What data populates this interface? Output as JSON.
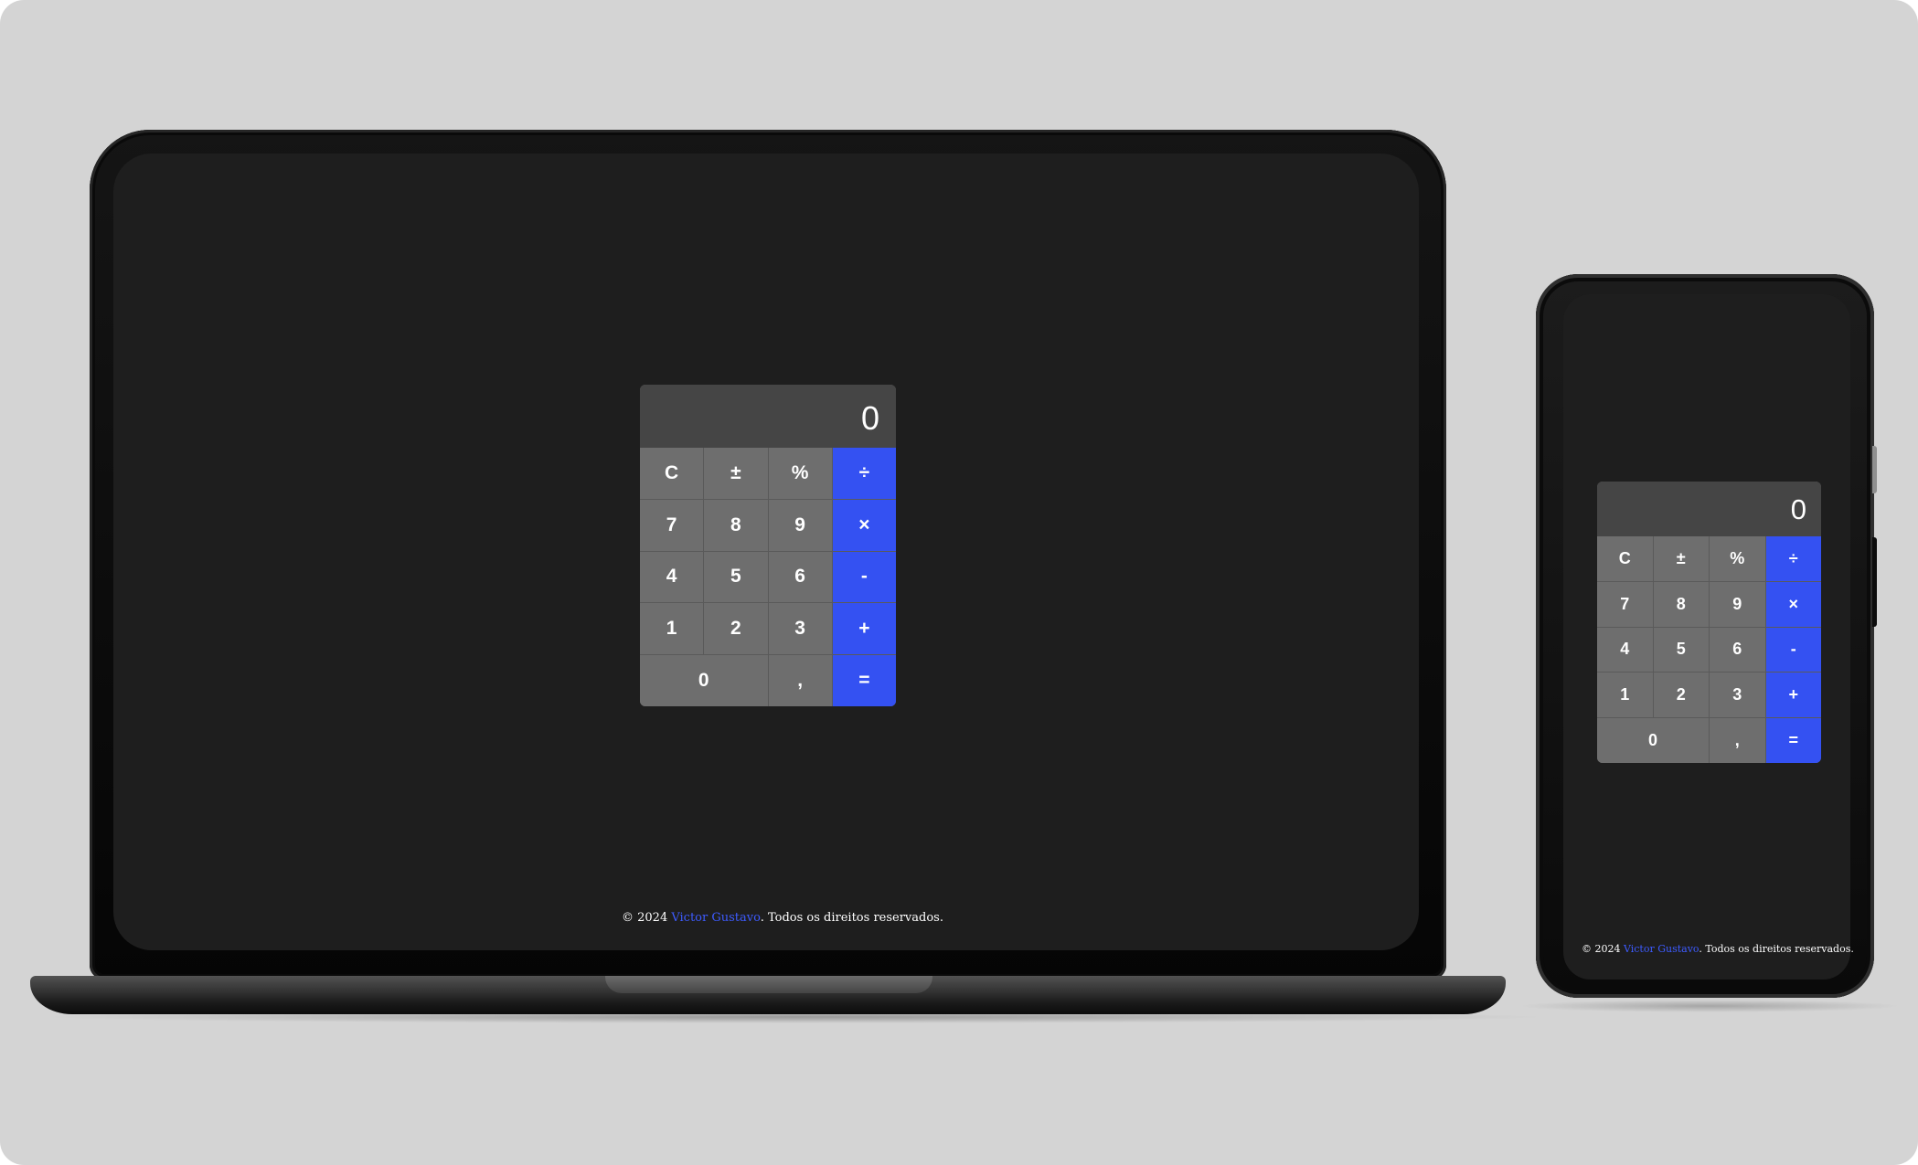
{
  "calculator": {
    "display_value": "0",
    "keys": [
      {
        "label": "C",
        "name": "clear-key",
        "type": "fn"
      },
      {
        "label": "±",
        "name": "sign-key",
        "type": "fn"
      },
      {
        "label": "%",
        "name": "percent-key",
        "type": "fn"
      },
      {
        "label": "÷",
        "name": "divide-key",
        "type": "op"
      },
      {
        "label": "7",
        "name": "digit-7-key",
        "type": "num"
      },
      {
        "label": "8",
        "name": "digit-8-key",
        "type": "num"
      },
      {
        "label": "9",
        "name": "digit-9-key",
        "type": "num"
      },
      {
        "label": "×",
        "name": "multiply-key",
        "type": "op"
      },
      {
        "label": "4",
        "name": "digit-4-key",
        "type": "num"
      },
      {
        "label": "5",
        "name": "digit-5-key",
        "type": "num"
      },
      {
        "label": "6",
        "name": "digit-6-key",
        "type": "num"
      },
      {
        "label": "-",
        "name": "subtract-key",
        "type": "op"
      },
      {
        "label": "1",
        "name": "digit-1-key",
        "type": "num"
      },
      {
        "label": "2",
        "name": "digit-2-key",
        "type": "num"
      },
      {
        "label": "3",
        "name": "digit-3-key",
        "type": "num"
      },
      {
        "label": "+",
        "name": "add-key",
        "type": "op"
      },
      {
        "label": "0",
        "name": "digit-0-key",
        "type": "zero"
      },
      {
        "label": ",",
        "name": "decimal-key",
        "type": "num"
      },
      {
        "label": "=",
        "name": "equals-key",
        "type": "op"
      }
    ]
  },
  "footer": {
    "prefix": "© 2024 ",
    "author": "Victor Gustavo",
    "suffix": ". Todos os direitos reservados."
  },
  "colors": {
    "background": "#d4d4d4",
    "screen": "#1e1e1e",
    "display": "#454545",
    "key": "#6e6e6e",
    "operator_key": "#3451f2",
    "link": "#3d5bff"
  }
}
